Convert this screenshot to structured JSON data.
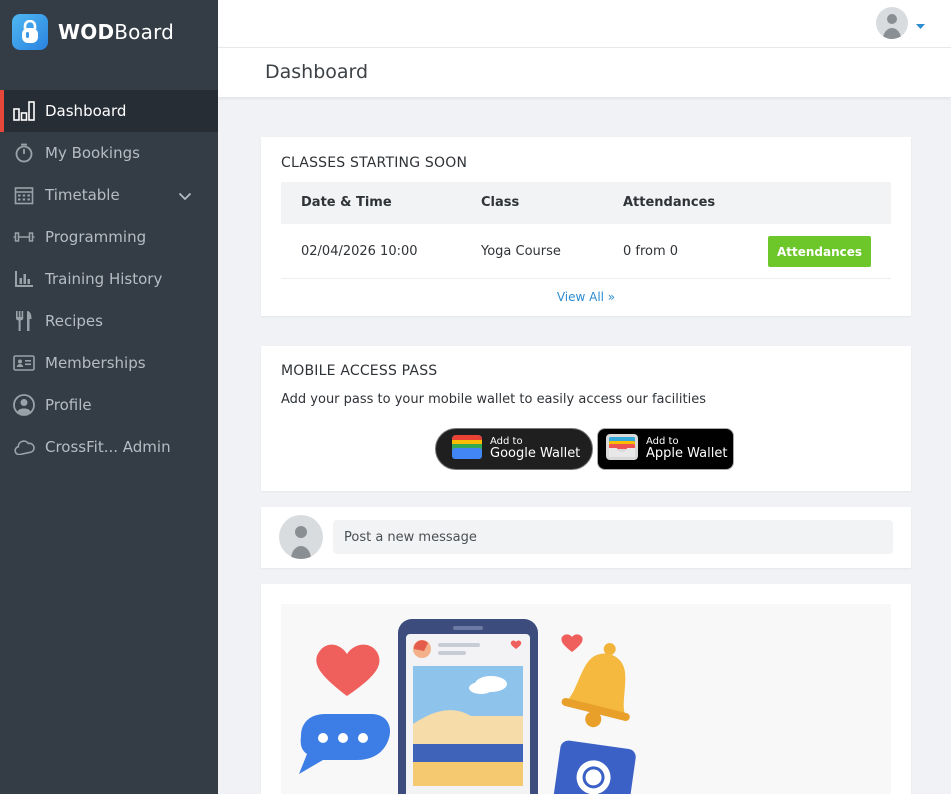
{
  "brand": {
    "name_bold": "WOD",
    "name_rest": "Board"
  },
  "sidebar": {
    "items": [
      {
        "label": "Dashboard",
        "icon": "bar-chart-icon"
      },
      {
        "label": "My Bookings",
        "icon": "stopwatch-icon"
      },
      {
        "label": "Timetable",
        "icon": "calendar-icon"
      },
      {
        "label": "Programming",
        "icon": "dumbbell-icon"
      },
      {
        "label": "Training History",
        "icon": "chart-icon"
      },
      {
        "label": "Recipes",
        "icon": "utensils-icon"
      },
      {
        "label": "Memberships",
        "icon": "id-card-icon"
      },
      {
        "label": "Profile",
        "icon": "user-circle-icon"
      },
      {
        "label": "CrossFit... Admin",
        "icon": "cloud-icon"
      }
    ]
  },
  "page": {
    "title": "Dashboard"
  },
  "classes": {
    "title": "CLASSES STARTING SOON",
    "columns": [
      "Date & Time",
      "Class",
      "Attendances"
    ],
    "rows": [
      {
        "datetime": "02/04/2026 10:00",
        "class": "Yoga Course",
        "attendances": "0 from 0",
        "button": "Attendances"
      }
    ],
    "view_all": "View All »"
  },
  "mobile_pass": {
    "title": "MOBILE ACCESS PASS",
    "description": "Add your pass to your mobile wallet to easily access our facilities",
    "google": {
      "small": "Add to",
      "big": "Google Wallet"
    },
    "apple": {
      "small": "Add to",
      "big": "Apple Wallet"
    }
  },
  "post": {
    "placeholder": "Post a new message"
  },
  "colors": {
    "sidebar": "#343d46",
    "active_marker": "#e5483b",
    "button_green": "#6dc62a",
    "link_blue": "#2c8ccf"
  }
}
